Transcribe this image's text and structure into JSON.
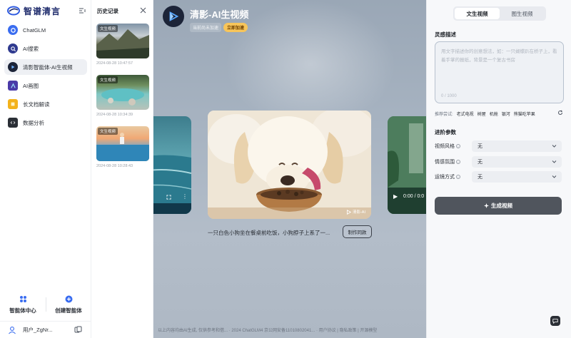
{
  "sidebar": {
    "brand": "智谱清言",
    "items": [
      {
        "label": "ChatGLM",
        "icon": "chatglm-icon",
        "color": "#3a6df0"
      },
      {
        "label": "AI搜索",
        "icon": "ai-search-icon",
        "color": "#2f3a8f"
      },
      {
        "label": "清影智能体-AI生视频",
        "icon": "video-play-icon",
        "color": "#1c2438"
      },
      {
        "label": "AI画图",
        "icon": "ai-draw-icon",
        "color": "#4a3aa8"
      },
      {
        "label": "长文档解读",
        "icon": "document-icon",
        "color": "#f3b21b"
      },
      {
        "label": "数据分析",
        "icon": "code-icon",
        "color": "#2b2f36"
      }
    ],
    "agent_center": "智能体中心",
    "create_agent": "创建智能体",
    "user_name": "用户_ZgNr..."
  },
  "history": {
    "title": "历史记录",
    "items": [
      {
        "tag": "文生视频",
        "date": "2024-08-28 10:47:57"
      },
      {
        "tag": "文生视频",
        "date": "2024-08-28 10:34:39"
      },
      {
        "tag": "文生视频",
        "date": "2024-08-28 10:28:43"
      }
    ]
  },
  "stage": {
    "title": "清影-AI生视频",
    "queue_label": "当前尚未加速",
    "speed_button": "立即加速",
    "caption": "一只白色小狗坐在餐桌前吃饭，小狗脖子上系了一...",
    "make_same_button": "制作同款",
    "watermark": "清影-AI",
    "right_time": "0:00 / 0:0",
    "footer": "以上内容均由AI生成, 仅供参考和借... · 2024 ChatGLM4 京公网安备11010802041... · 用户协议 | 隐私政策 | 开源模型"
  },
  "panel": {
    "tabs": [
      "文生视频",
      "图生视频"
    ],
    "active_tab": 0,
    "prompt_title": "灵感描述",
    "prompt_placeholder": "用文字描述你的创意想法，如：一只蝴蝶趴在桥子上，看着手掌的报纸，背景是一个复古书房",
    "prompt_count": "0 / 1000",
    "recommend_label": "推荐尝试:",
    "recommend_words": [
      "老式电视",
      "树屋",
      "机舱",
      "银河",
      "熊猫吃苹果"
    ],
    "advanced_title": "进阶参数",
    "params": [
      {
        "label": "视频风格",
        "value": "无"
      },
      {
        "label": "情感氛围",
        "value": "无"
      },
      {
        "label": "运镜方式",
        "value": "无"
      }
    ],
    "generate_button": "生成视频"
  }
}
